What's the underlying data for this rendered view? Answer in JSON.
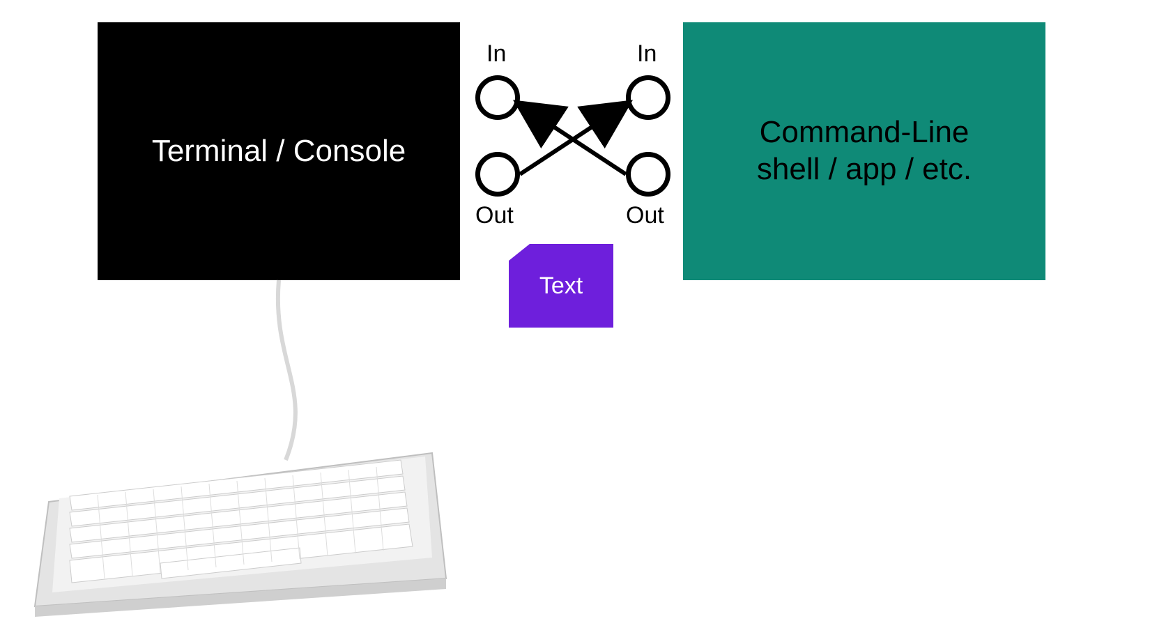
{
  "terminal": {
    "label": "Terminal / Console"
  },
  "app": {
    "line1": "Command-Line",
    "line2": "shell / app / etc."
  },
  "ports": {
    "left_in": "In",
    "left_out": "Out",
    "right_in": "In",
    "right_out": "Out"
  },
  "note": {
    "label": "Text"
  },
  "colors": {
    "terminal_bg": "#000000",
    "app_bg": "#0f8a77",
    "note_bg": "#6e1fdc"
  }
}
